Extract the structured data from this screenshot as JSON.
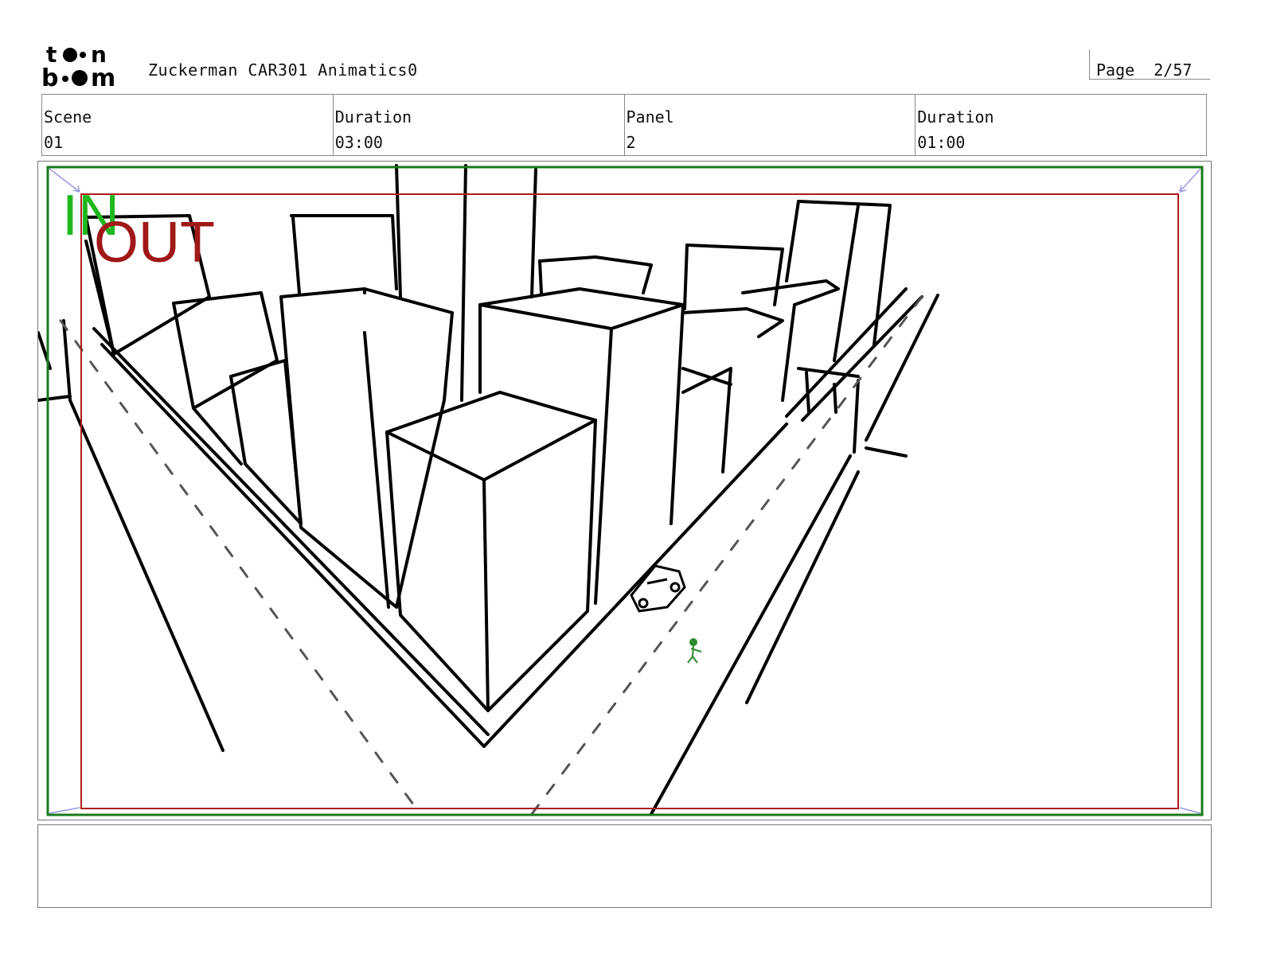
{
  "header": {
    "logo_text": "toon boom",
    "document_title": "Zuckerman CAR301 Animatics0",
    "page_label": "Page  2/57"
  },
  "info": [
    {
      "label": "Scene",
      "value": "01"
    },
    {
      "label": "Duration",
      "value": "03:00"
    },
    {
      "label": "Panel",
      "value": "2"
    },
    {
      "label": "Duration",
      "value": "01:00"
    }
  ],
  "panel": {
    "in_label": "IN",
    "out_label": "OUT",
    "in_frame_color": "#1a7a1a",
    "out_frame_color": "#b01c1c",
    "figure_color": "#2e8b2e"
  },
  "notes": {
    "text": ""
  }
}
